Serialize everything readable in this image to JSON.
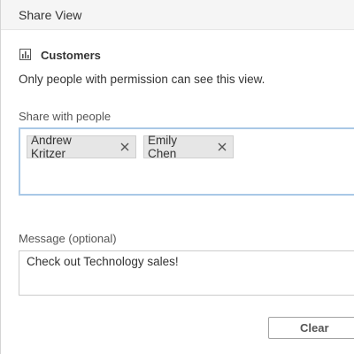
{
  "dialog": {
    "title": "Share View"
  },
  "view": {
    "icon": "bar-chart-icon",
    "name": "Customers"
  },
  "permission_text": "Only people with permission can see this view.",
  "share_with": {
    "label": "Share with people",
    "people": [
      {
        "name": "Andrew Kritzer",
        "remove_icon": "close-icon"
      },
      {
        "name": "Emily Chen",
        "remove_icon": "close-icon"
      }
    ]
  },
  "message": {
    "label": "Message (optional)",
    "value": "Check out Technology sales!"
  },
  "buttons": {
    "clear_label": "Clear"
  },
  "colors": {
    "focus_border": "#a9c8e6",
    "chip_background": "#e6e6e6",
    "titlebar_background": "#f5f5f5"
  }
}
